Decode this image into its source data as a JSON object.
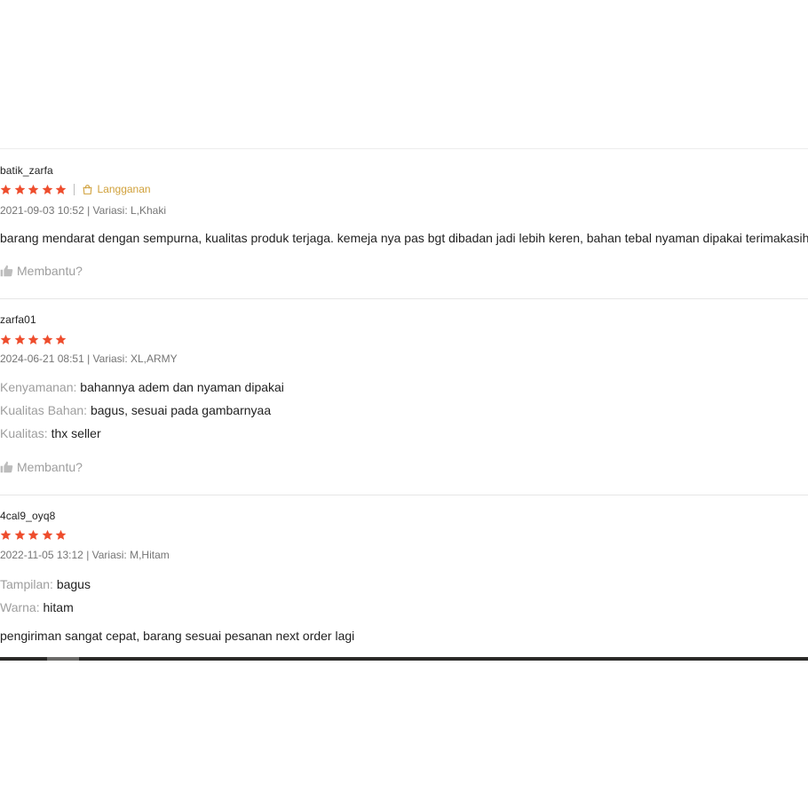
{
  "colors": {
    "star": "#ee4d2d",
    "badge": "#d0a03a",
    "meta_text": "#757575",
    "label_text": "#9e9e9e",
    "scrollbar": "#2b2a28"
  },
  "reviews": [
    {
      "username": "batik_zarfa",
      "rating": 5,
      "badge": {
        "icon": "shopping-bag-icon",
        "label": "Langganan"
      },
      "meta": "2021-09-03 10:52 | Variasi: L,Khaki",
      "comment": "barang mendarat dengan sempurna, kualitas produk terjaga. kemeja nya pas bgt dibadan jadi lebih keren, bahan tebal nyaman dipakai terimakasih",
      "helpful": {
        "icon": "thumbs-up-icon",
        "label": "Membantu?"
      }
    },
    {
      "username": "zarfa01",
      "rating": 5,
      "meta": "2024-06-21 08:51 | Variasi: XL,ARMY",
      "attributes": [
        {
          "key": "Kenyamanan:",
          "value": "bahannya adem dan nyaman dipakai"
        },
        {
          "key": "Kualitas Bahan:",
          "value": "bagus, sesuai pada gambarnyaa"
        },
        {
          "key": "Kualitas:",
          "value": "thx seller"
        }
      ],
      "helpful": {
        "icon": "thumbs-up-icon",
        "label": "Membantu?"
      }
    },
    {
      "username": "4cal9_oyq8",
      "rating": 5,
      "meta": "2022-11-05 13:12 | Variasi: M,Hitam",
      "attributes": [
        {
          "key": "Tampilan:",
          "value": "bagus"
        },
        {
          "key": "Warna:",
          "value": "hitam"
        }
      ],
      "comment": "pengiriman sangat cepat, barang sesuai pesanan next order lagi"
    }
  ]
}
